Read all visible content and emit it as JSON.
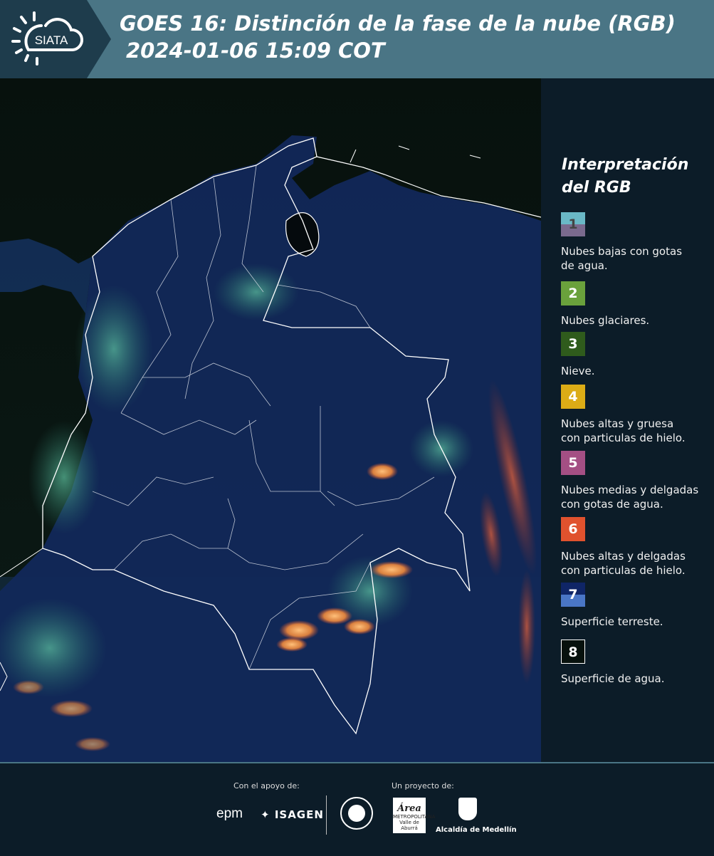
{
  "header": {
    "logo_text": "SIATA",
    "title_line1": "GOES 16: Distinción de la fase de la nube (RGB)",
    "title_line2": "2024-01-06 15:09 COT"
  },
  "legend": {
    "title_line1": "Interpretación",
    "title_line2": "del RGB",
    "items": [
      {
        "num": "1",
        "colors": [
          "#6ab8c6",
          "#7a6a8e"
        ],
        "text_lines": [
          "Nubes bajas con gotas",
          "de agua."
        ]
      },
      {
        "num": "2",
        "colors": [
          "#6aa13c"
        ],
        "text_lines": [
          "Nubes glaciares."
        ]
      },
      {
        "num": "3",
        "colors": [
          "#2f5b1c"
        ],
        "text_lines": [
          "Nieve."
        ]
      },
      {
        "num": "4",
        "colors": [
          "#dcac16"
        ],
        "text_lines": [
          "Nubes altas y gruesa",
          "con particulas de hielo."
        ]
      },
      {
        "num": "5",
        "colors": [
          "#a44f84"
        ],
        "text_lines": [
          "Nubes medias y delgadas",
          "con gotas de agua."
        ]
      },
      {
        "num": "6",
        "colors": [
          "#e0522e"
        ],
        "text_lines": [
          "Nubes altas y delgadas",
          "con particulas de hielo."
        ]
      },
      {
        "num": "7",
        "colors": [
          "#0f2566",
          "#4a76c6"
        ],
        "text_lines": [
          "Superficie terreste."
        ]
      },
      {
        "num": "8",
        "colors": [
          "#07110d"
        ],
        "text_lines": [
          "Superficie de agua."
        ]
      }
    ]
  },
  "footer": {
    "support_label": "Con el apoyo de:",
    "project_label": "Un proyecto de:",
    "epm": "epm",
    "isagen": "ISAGEN",
    "area_logo": "Área",
    "area_sub": "METROPOLITANA Valle de Aburrá",
    "alcaldia": "Alcaldía de Medellín"
  },
  "colors": {
    "header_bg": "#4a7585",
    "logo_bg": "#1e3c4c",
    "page_bg": "#0c1c28",
    "map_land": "#10234a",
    "map_sea": "#050a0d"
  }
}
